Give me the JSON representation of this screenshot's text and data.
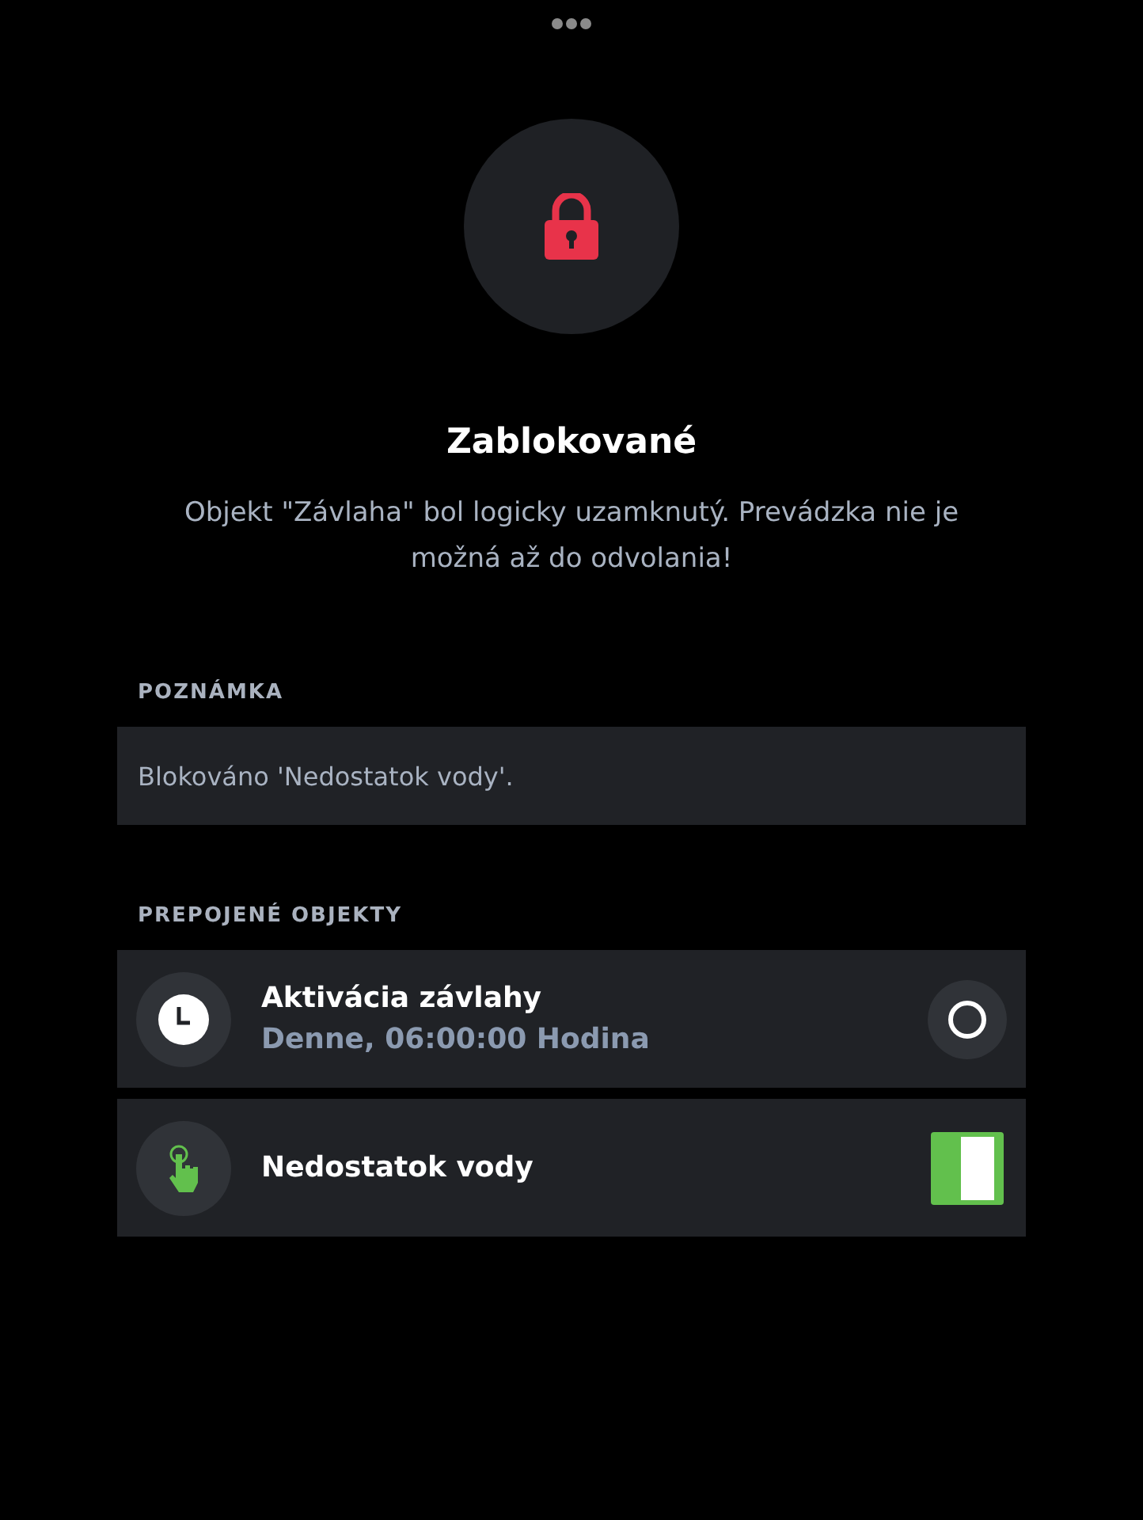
{
  "status": {
    "title": "Zablokované",
    "description": "Objekt \"Závlaha\" bol logicky uzamknutý. Prevádzka nie je možná až do odvolania!"
  },
  "note": {
    "label": "POZNÁMKA",
    "text": "Blokováno 'Nedostatok vody'."
  },
  "linked": {
    "label": "PREPOJENÉ OBJEKTY",
    "items": [
      {
        "kind": "timer",
        "title": "Aktivácia závlahy",
        "subtitle": "Denne, 06:00:00 Hodina"
      },
      {
        "kind": "switch",
        "title": "Nedostatok vody",
        "on": true
      }
    ]
  }
}
